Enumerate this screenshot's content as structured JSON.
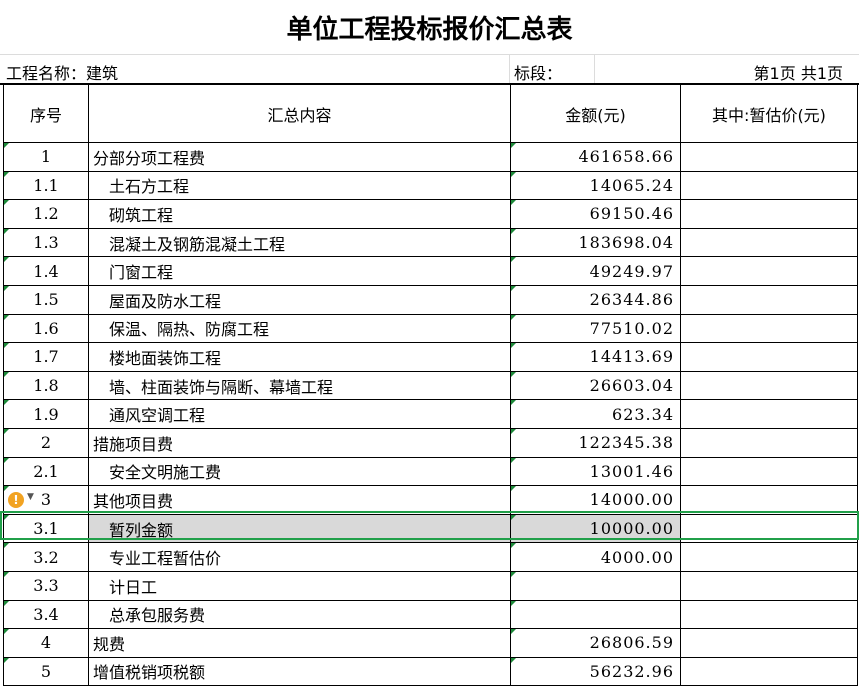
{
  "title": "单位工程投标报价汇总表",
  "meta": {
    "project_label": "工程名称：建筑",
    "section_label": "标段：",
    "page_info": "第1页  共1页"
  },
  "headers": {
    "seq": "序号",
    "content": "汇总内容",
    "amount": "金额(元)",
    "provisional": "其中:暂估价(元)"
  },
  "rows": [
    {
      "seq": "1",
      "name": "分部分项工程费",
      "amount": "461658.66",
      "provisional": "",
      "sub": false
    },
    {
      "seq": "1.1",
      "name": "土石方工程",
      "amount": "14065.24",
      "provisional": "",
      "sub": true
    },
    {
      "seq": "1.2",
      "name": "砌筑工程",
      "amount": "69150.46",
      "provisional": "",
      "sub": true
    },
    {
      "seq": "1.3",
      "name": "混凝土及钢筋混凝土工程",
      "amount": "183698.04",
      "provisional": "",
      "sub": true
    },
    {
      "seq": "1.4",
      "name": "门窗工程",
      "amount": "49249.97",
      "provisional": "",
      "sub": true
    },
    {
      "seq": "1.5",
      "name": "屋面及防水工程",
      "amount": "26344.86",
      "provisional": "",
      "sub": true
    },
    {
      "seq": "1.6",
      "name": "保温、隔热、防腐工程",
      "amount": "77510.02",
      "provisional": "",
      "sub": true
    },
    {
      "seq": "1.7",
      "name": "楼地面装饰工程",
      "amount": "14413.69",
      "provisional": "",
      "sub": true
    },
    {
      "seq": "1.8",
      "name": "墙、柱面装饰与隔断、幕墙工程",
      "amount": "26603.04",
      "provisional": "",
      "sub": true
    },
    {
      "seq": "1.9",
      "name": "通风空调工程",
      "amount": "623.34",
      "provisional": "",
      "sub": true
    },
    {
      "seq": "2",
      "name": "措施项目费",
      "amount": "122345.38",
      "provisional": "",
      "sub": false
    },
    {
      "seq": "2.1",
      "name": "安全文明施工费",
      "amount": "13001.46",
      "provisional": "",
      "sub": true
    },
    {
      "seq": "3",
      "name": "其他项目费",
      "amount": "14000.00",
      "provisional": "",
      "sub": false
    },
    {
      "seq": "3.1",
      "name": "暂列金额",
      "amount": "10000.00",
      "provisional": "",
      "sub": true
    },
    {
      "seq": "3.2",
      "name": "专业工程暂估价",
      "amount": "4000.00",
      "provisional": "",
      "sub": true
    },
    {
      "seq": "3.3",
      "name": "计日工",
      "amount": "",
      "provisional": "",
      "sub": true
    },
    {
      "seq": "3.4",
      "name": "总承包服务费",
      "amount": "",
      "provisional": "",
      "sub": true
    },
    {
      "seq": "4",
      "name": "规费",
      "amount": "26806.59",
      "provisional": "",
      "sub": false
    },
    {
      "seq": "5",
      "name": "增值税销项税额",
      "amount": "56232.96",
      "provisional": "",
      "sub": false
    }
  ],
  "warning_icon": "!",
  "colors": {
    "selection": "#21a04a",
    "selected_fill": "#d9d9d9",
    "warning": "#f2a322",
    "corner_marker": "#1d8a3a"
  }
}
